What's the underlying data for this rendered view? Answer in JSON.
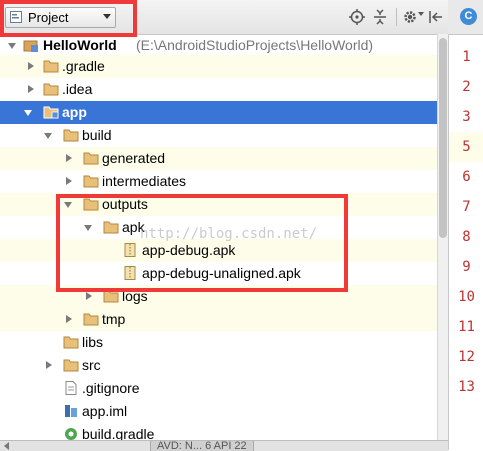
{
  "toolbar": {
    "view_selector": "Project",
    "icons": [
      "crosshair-icon",
      "collapse-all-icon",
      "gear-icon",
      "hide-panel-icon"
    ]
  },
  "editor": {
    "tab_icon_letter": "C",
    "line_numbers": [
      "1",
      "2",
      "3",
      "5",
      "6",
      "7",
      "8",
      "9",
      "10",
      "11",
      "12",
      "13"
    ]
  },
  "tree": {
    "root": {
      "name": "HelloWorld",
      "path": "(E:\\AndroidStudioProjects\\HelloWorld)"
    },
    "items": [
      {
        "label": ".gradle"
      },
      {
        "label": ".idea"
      },
      {
        "label": "app"
      },
      {
        "label": "build"
      },
      {
        "label": "generated"
      },
      {
        "label": "intermediates"
      },
      {
        "label": "outputs"
      },
      {
        "label": "apk"
      },
      {
        "label": "app-debug.apk"
      },
      {
        "label": "app-debug-unaligned.apk"
      },
      {
        "label": "logs"
      },
      {
        "label": "tmp"
      },
      {
        "label": "libs"
      },
      {
        "label": "src"
      },
      {
        "label": ".gitignore"
      },
      {
        "label": "app.iml"
      },
      {
        "label": "build.gradle"
      }
    ]
  },
  "status": {
    "device": "AVD: N... 6  API 22"
  },
  "watermark": "http://blog.csdn.net/",
  "colors": {
    "selection": "#3875d7",
    "highlight": "#fdfdea",
    "folder": "#d9a35b",
    "annotation": "#f03a3a",
    "line_number": "#bb3333"
  }
}
